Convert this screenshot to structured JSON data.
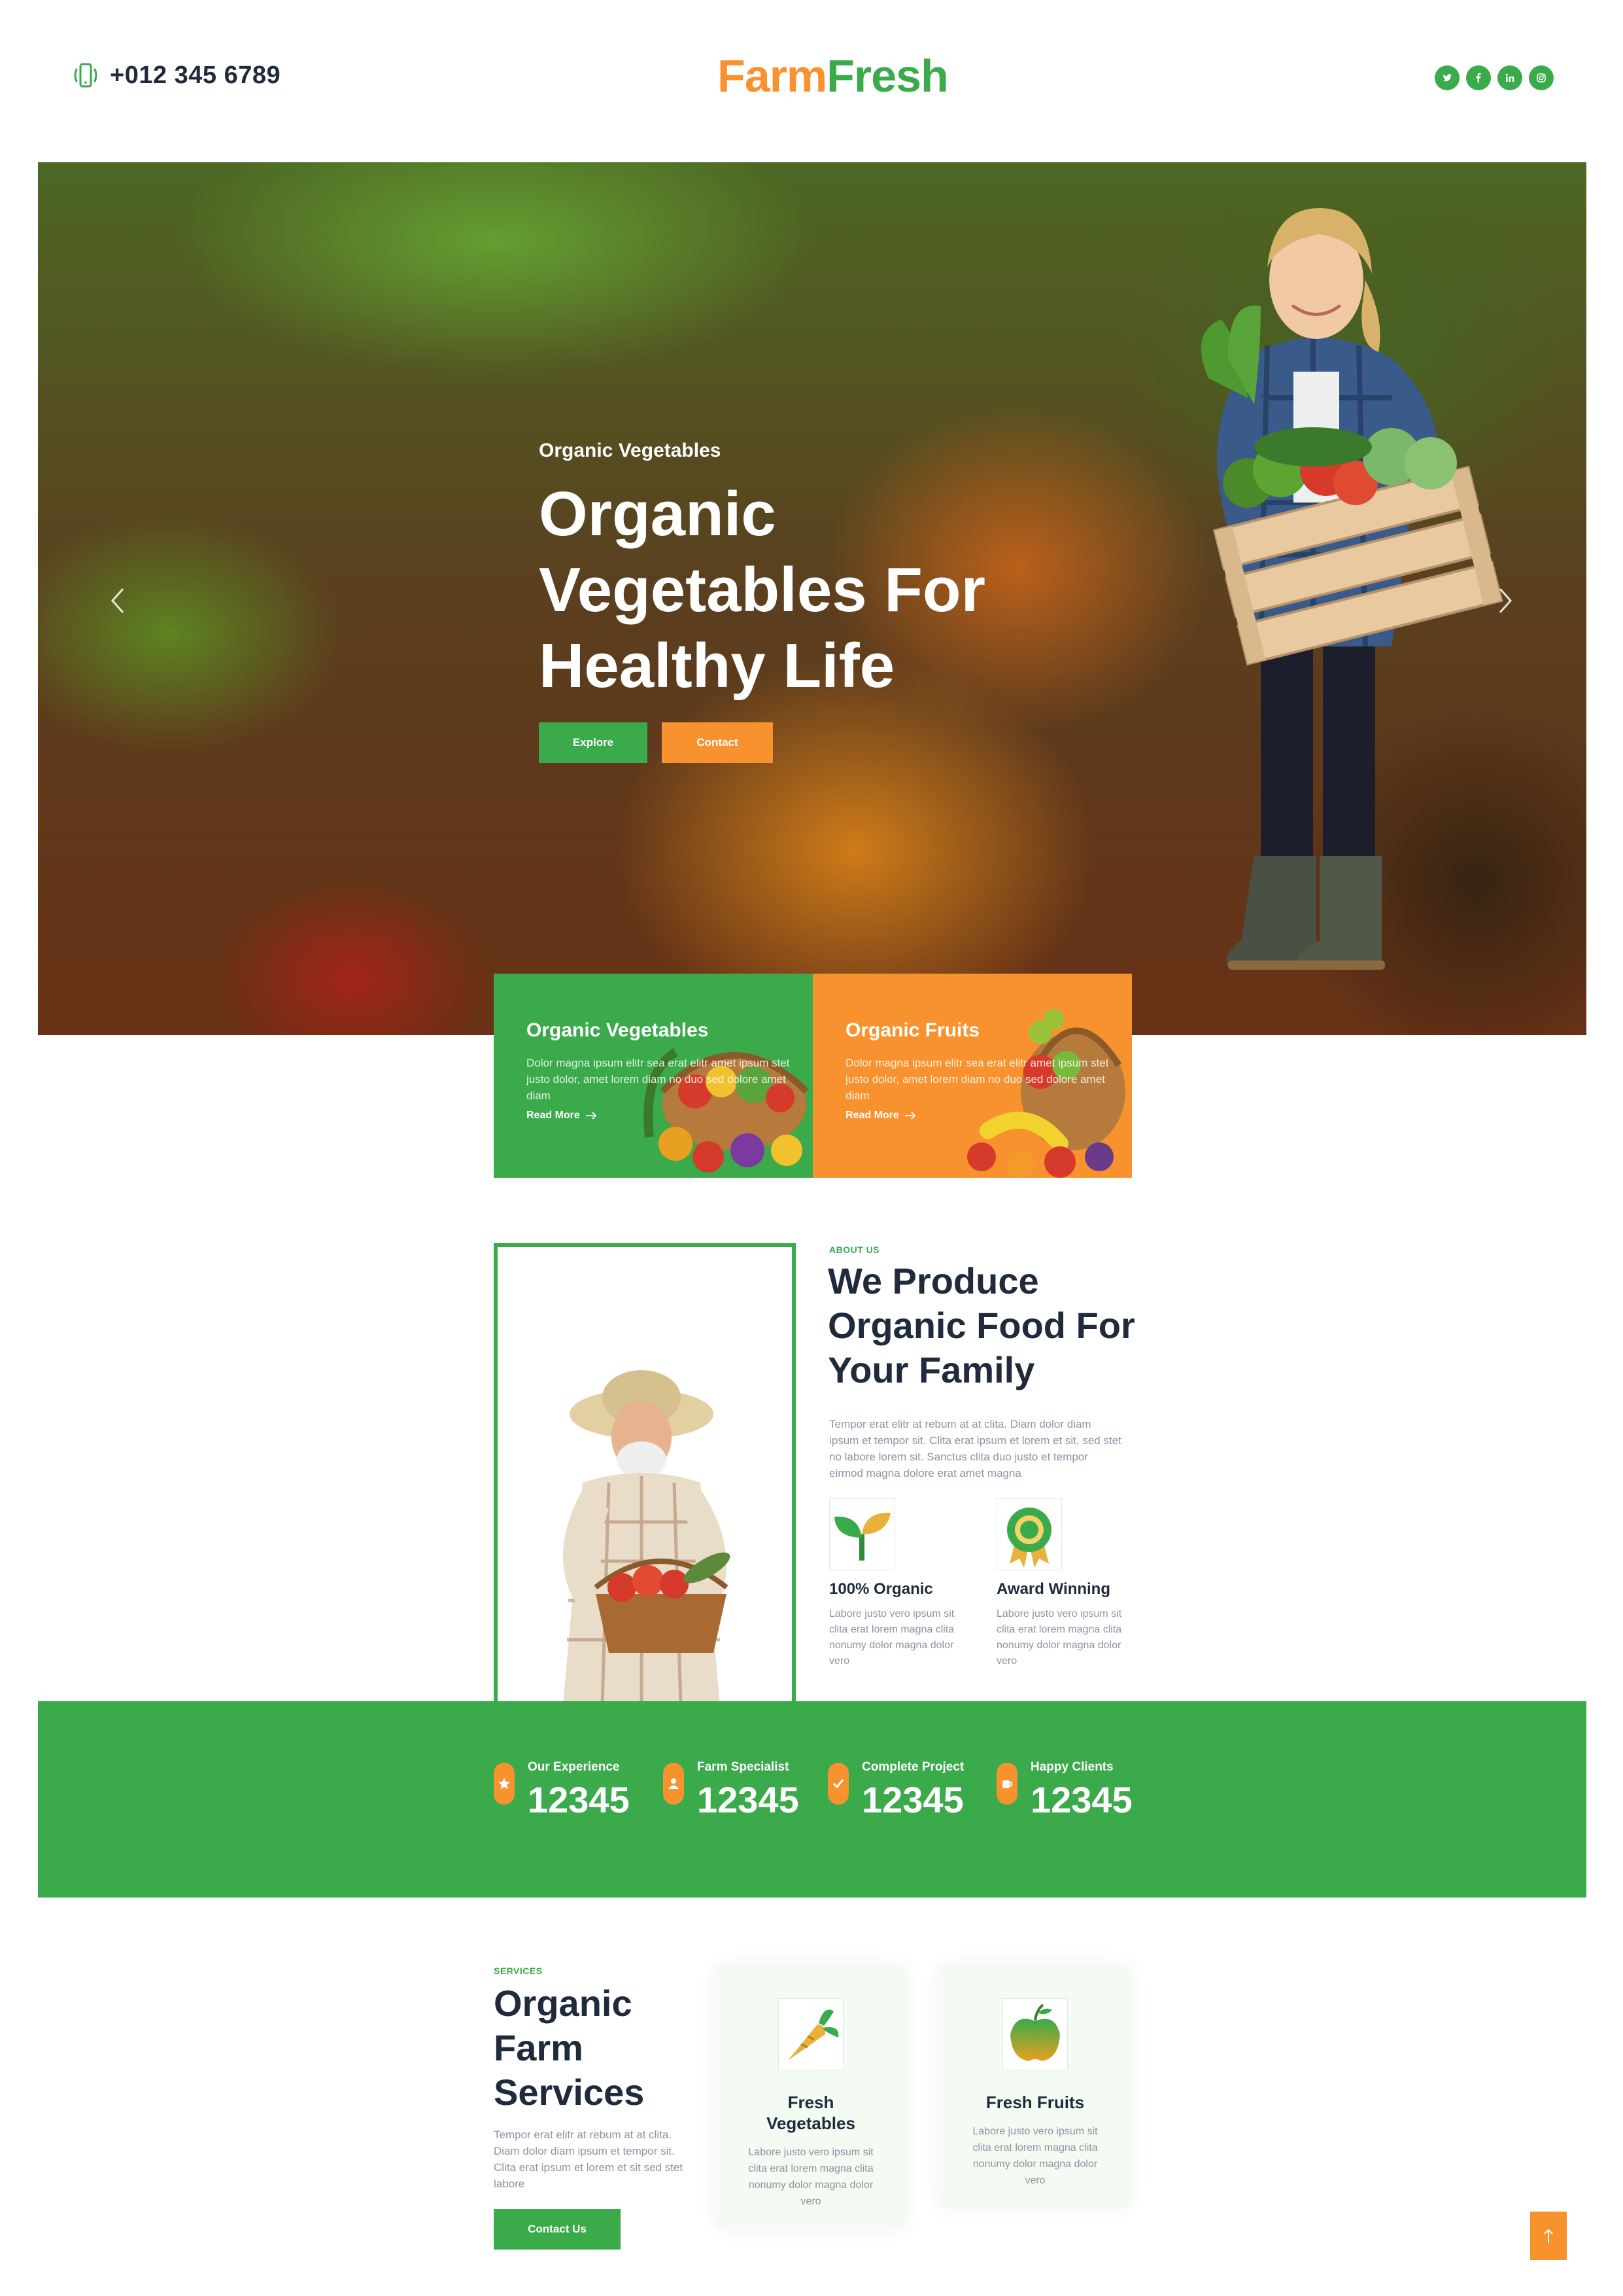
{
  "header": {
    "phone": "+012 345 6789",
    "logo_part1": "Farm",
    "logo_part2": "Fresh",
    "socials": [
      "twitter-icon",
      "facebook-icon",
      "linkedin-icon",
      "instagram-icon"
    ]
  },
  "hero": {
    "subtitle": "Organic Vegetables",
    "title": "Organic Vegetables For Healthy Life",
    "btn_explore": "Explore",
    "btn_contact": "Contact"
  },
  "features": [
    {
      "title": "Organic Vegetables",
      "text": "Dolor magna ipsum elitr sea erat elitr amet ipsum stet justo dolor, amet lorem diam no duo sed dolore amet diam",
      "link": "Read More"
    },
    {
      "title": "Organic Fruits",
      "text": "Dolor magna ipsum elitr sea erat elitr amet ipsum stet justo dolor, amet lorem diam no duo sed dolore amet diam",
      "link": "Read More"
    }
  ],
  "about": {
    "label": "ABOUT US",
    "title": "We Produce Organic Food For Your Family",
    "text": "Tempor erat elitr at rebum at at clita. Diam dolor diam ipsum et tempor sit. Clita erat ipsum et lorem et sit, sed stet no labore lorem sit. Sanctus clita duo justo et tempor eirmod magna dolore erat amet magna",
    "items": [
      {
        "title": "100% Organic",
        "text": "Labore justo vero ipsum sit clita erat lorem magna clita nonumy dolor magna dolor vero"
      },
      {
        "title": "Award Winning",
        "text": "Labore justo vero ipsum sit clita erat lorem magna clita nonumy dolor magna dolor vero"
      }
    ]
  },
  "stats": [
    {
      "label": "Our Experience",
      "value": "12345"
    },
    {
      "label": "Farm Specialist",
      "value": "12345"
    },
    {
      "label": "Complete Project",
      "value": "12345"
    },
    {
      "label": "Happy Clients",
      "value": "12345"
    }
  ],
  "services": {
    "label": "SERVICES",
    "title": "Organic Farm Services",
    "text": "Tempor erat elitr at rebum at at clita. Diam dolor diam ipsum et tempor sit. Clita erat ipsum et lorem et sit sed stet labore",
    "button": "Contact Us",
    "cards": [
      {
        "title": "Fresh Vegetables",
        "text": "Labore justo vero ipsum sit clita erat lorem magna clita nonumy dolor magna dolor vero"
      },
      {
        "title": "Fresh Fruits",
        "text": "Labore justo vero ipsum sit clita erat lorem magna clita nonumy dolor magna dolor vero"
      }
    ]
  },
  "colors": {
    "green": "#3aaa4b",
    "orange": "#f7922f",
    "dark": "#1f2b3d",
    "muted": "#8a95a3"
  }
}
